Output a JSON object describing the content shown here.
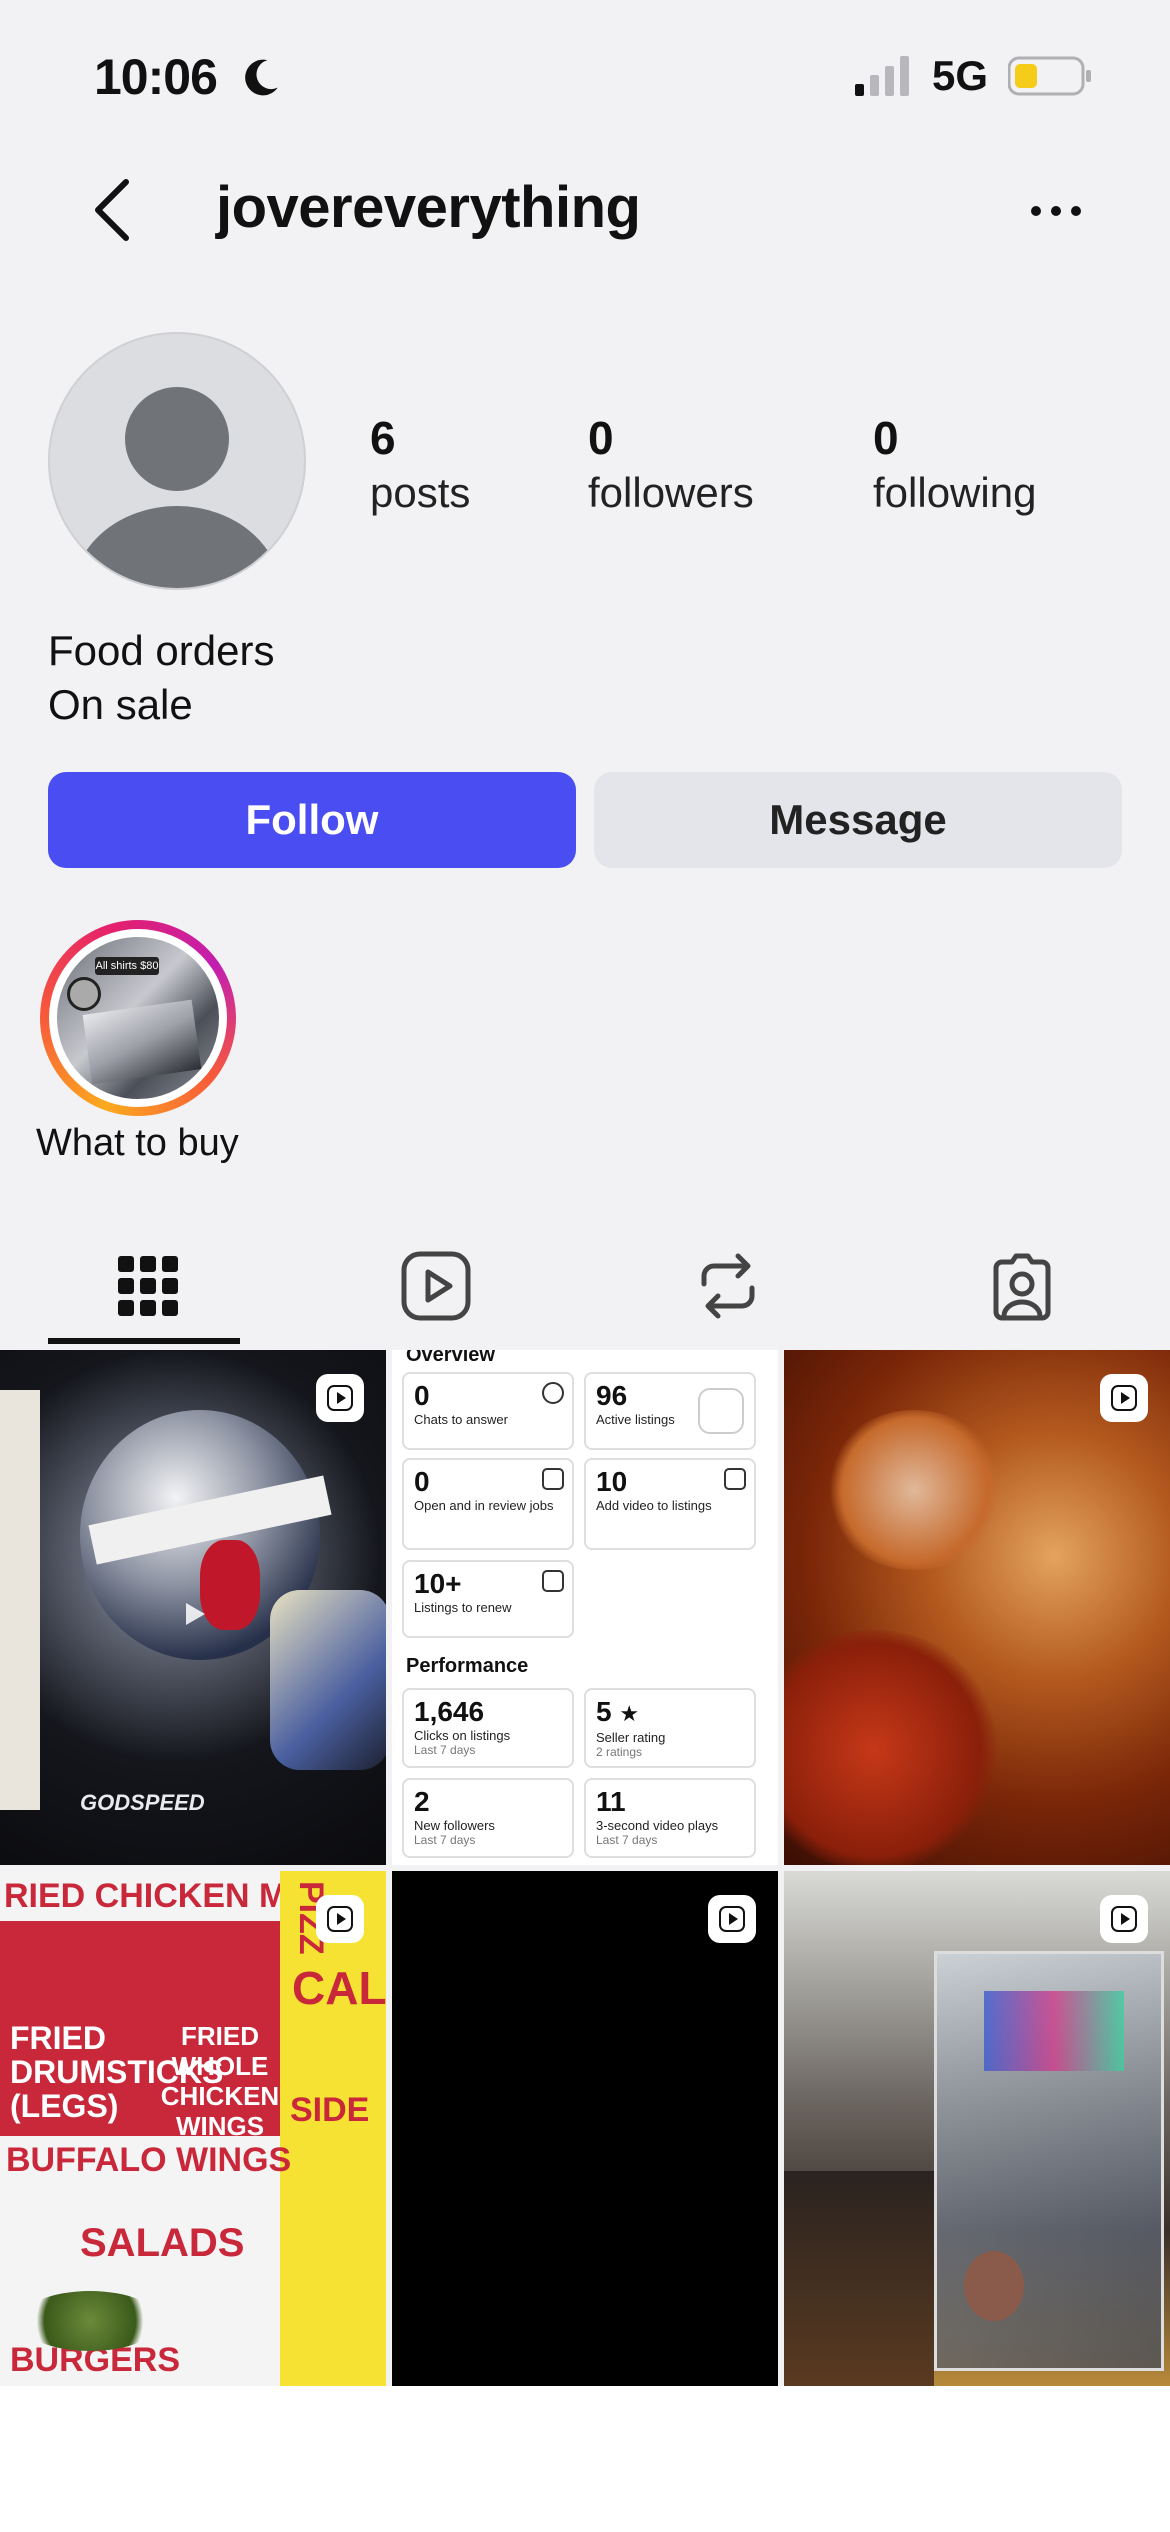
{
  "status_bar": {
    "time": "10:06",
    "network": "5G"
  },
  "nav": {
    "username": "jovereverything"
  },
  "profile": {
    "stats": [
      {
        "value": "6",
        "label": "posts"
      },
      {
        "value": "0",
        "label": "followers"
      },
      {
        "value": "0",
        "label": "following"
      }
    ],
    "bio": [
      "Food orders",
      "On sale"
    ]
  },
  "actions": {
    "follow": "Follow",
    "message": "Message"
  },
  "highlights": [
    {
      "label": "What to buy",
      "badge": "All shirts $80"
    }
  ],
  "tabs": [
    "posts-grid-icon",
    "reels-icon",
    "reposts-icon",
    "tagged-icon"
  ],
  "grid": {
    "cells": [
      {
        "type": "video",
        "caption": "GODSPEED"
      },
      {
        "type": "image",
        "overview": {
          "heading": "Overview",
          "cards": [
            {
              "value": "0",
              "desc": "Chats to answer"
            },
            {
              "value": "96",
              "desc": "Active listings"
            },
            {
              "value": "0",
              "desc": "Open and in review jobs"
            },
            {
              "value": "10",
              "desc": "Add video to listings"
            },
            {
              "value": "10+",
              "desc": "Listings to renew"
            }
          ],
          "performance_heading": "Performance",
          "performance": [
            {
              "value": "1,646",
              "desc": "Clicks on listings",
              "sub": "Last 7 days"
            },
            {
              "value": "5",
              "desc": "Seller rating",
              "sub": "2 ratings"
            },
            {
              "value": "2",
              "desc": "New followers",
              "sub": "Last 7 days"
            },
            {
              "value": "11",
              "desc": "3-second video plays",
              "sub": "Last 7 days"
            }
          ]
        }
      },
      {
        "type": "video"
      },
      {
        "type": "video",
        "menu": {
          "title": "RIED CHICKEN MIX",
          "items": [
            "FRIED DRUMSTICKS (LEGS)",
            "FRIED WHOLE CHICKEN WINGS",
            "BUFFALO WINGS",
            "SALADS",
            "BURGERS",
            "SIDE",
            "PIZZ",
            "CAL"
          ]
        }
      },
      {
        "type": "video"
      },
      {
        "type": "video"
      }
    ]
  },
  "colors": {
    "accent": "#4a4ef2",
    "background": "#f2f2f4",
    "message_bg": "#e4e5ea"
  }
}
